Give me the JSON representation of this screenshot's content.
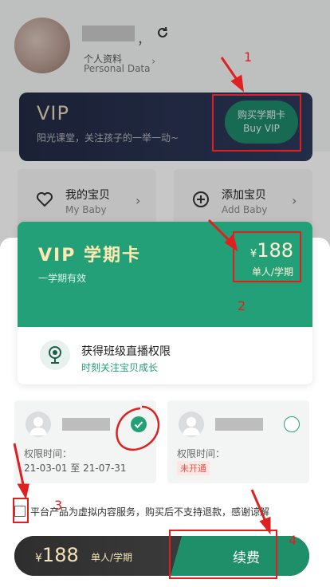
{
  "profile": {
    "separator": "，",
    "label_zh": "个人资料",
    "label_en": "Personal Data",
    "arrow": "›"
  },
  "vip_banner": {
    "title": "VIP",
    "subtitle": "阳光课堂，关注孩子的一举一动~",
    "button_zh": "购买学期卡",
    "button_en": "Buy VIP"
  },
  "menu": [
    {
      "label_zh": "我的宝贝",
      "label_en": "My Baby",
      "icon": "heart-icon",
      "arrow": "›"
    },
    {
      "label_zh": "添加宝贝",
      "label_en": "Add Baby",
      "icon": "plus-circle-icon",
      "arrow": "›"
    }
  ],
  "vip_card": {
    "title": "VIP 学期卡",
    "subtitle": "一学期有效",
    "currency": "¥",
    "price": "188",
    "unit": "单人/学期",
    "benefit_title": "获得班级直播权限",
    "benefit_sub": "时刻关注宝贝成长"
  },
  "babies": [
    {
      "period_label": "权限时间：",
      "period_value": "21-03-01 至 21-07-31",
      "selected": true
    },
    {
      "period_label": "权限时间：",
      "period_value": "未开通",
      "selected": false
    }
  ],
  "agreement": {
    "text": "平台产品为虚拟内容服务，购买后不支持退款，感谢谅解"
  },
  "pay_bar": {
    "currency": "¥",
    "price": "188",
    "unit": "单人/学期",
    "button": "续费"
  },
  "annotations": {
    "n1": "1",
    "n2": "2",
    "n3": "3",
    "n4": "4"
  },
  "colors": {
    "brand_green": "#23a077",
    "annotation_red": "#e02020",
    "gold": "#fff4d8"
  }
}
